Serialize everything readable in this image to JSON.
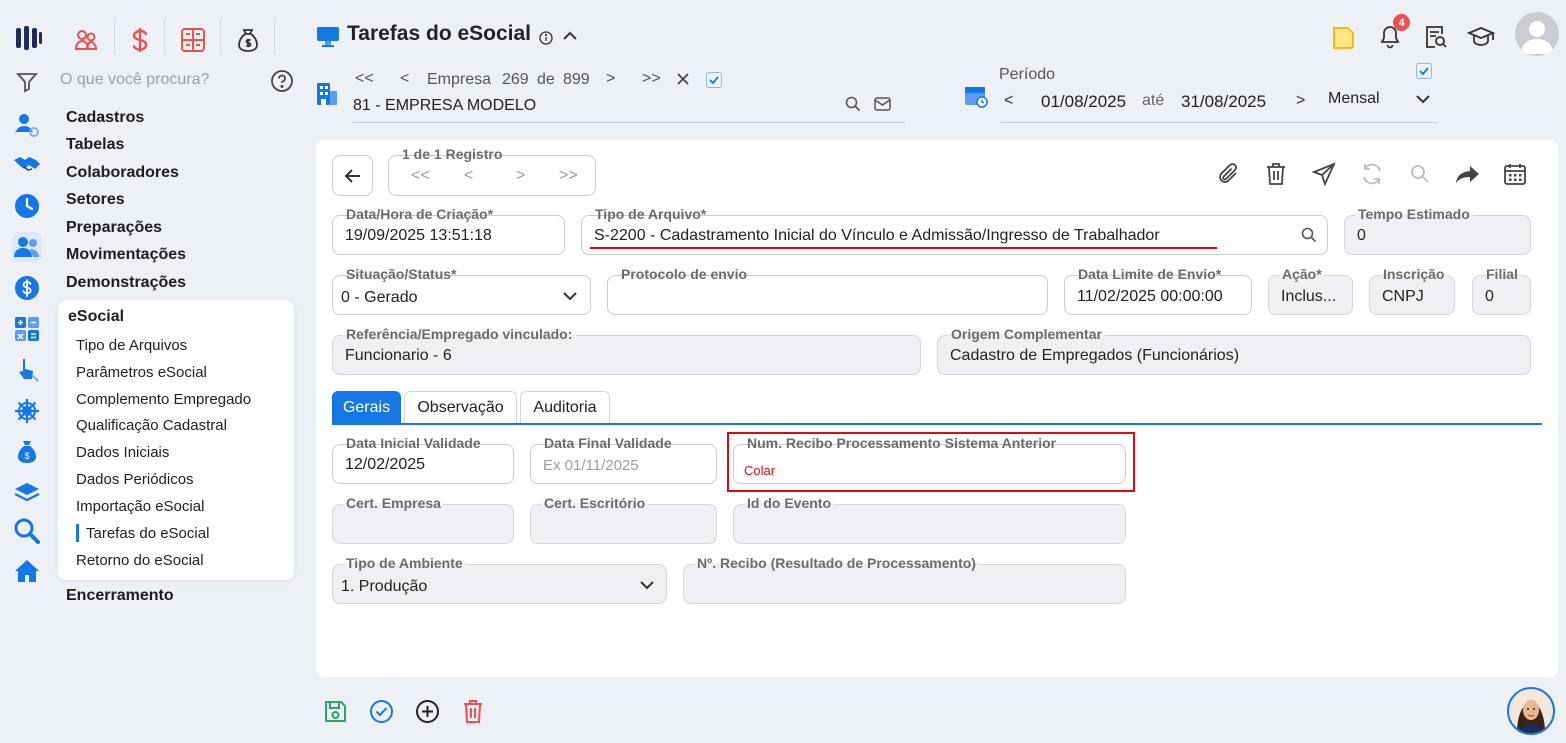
{
  "app": {
    "title": "Tarefas do eSocial",
    "search_placeholder": "O que você procura?",
    "notifications_count": "4"
  },
  "menu": {
    "main_items": [
      "Cadastros",
      "Tabelas",
      "Colaboradores",
      "Setores",
      "Preparações",
      "Movimentações",
      "Demonstrações"
    ],
    "submenu_title": "eSocial",
    "sub_items": [
      "Tipo de Arquivos",
      "Parâmetros eSocial",
      "Complemento Empregado",
      "Qualificação Cadastral",
      "Dados Iniciais",
      "Dados Periódicos",
      "Importação eSocial",
      "Tarefas do eSocial",
      "Retorno do eSocial"
    ],
    "active_sub_item": "Tarefas do eSocial",
    "last_item": "Encerramento"
  },
  "company": {
    "nav_label": "Empresa",
    "current": "269",
    "of_label": "de",
    "total": "899",
    "name": "81 - EMPRESA MODELO"
  },
  "period": {
    "label": "Período",
    "start": "01/08/2025",
    "until": "até",
    "end": "31/08/2025",
    "mode": "Mensal"
  },
  "record_nav": {
    "label": "1 de 1 Registro"
  },
  "form": {
    "creation": {
      "label": "Data/Hora de Criação*",
      "value": "19/09/2025 13:51:18"
    },
    "file_type": {
      "label": "Tipo de Arquivo*",
      "value": "S-2200 - Cadastramento Inicial do Vínculo e Admissão/Ingresso de Trabalhador"
    },
    "estimated_time": {
      "label": "Tempo Estimado",
      "value": "0"
    },
    "status": {
      "label": "Situação/Status*",
      "value": "0 - Gerado"
    },
    "protocol": {
      "label": "Protocolo de envio",
      "value": ""
    },
    "deadline": {
      "label": "Data Limite de Envio*",
      "value": "11/02/2025 00:00:00"
    },
    "action": {
      "label": "Ação*",
      "value": "Inclus..."
    },
    "registration": {
      "label": "Inscrição",
      "value": "CNPJ"
    },
    "branch": {
      "label": "Filial",
      "value": "0"
    },
    "reference": {
      "label": "Referência/Empregado vinculado:",
      "value": "Funcionario - 6"
    },
    "origin": {
      "label": "Origem Complementar",
      "value": "Cadastro de Empregados (Funcionários)"
    }
  },
  "tabs": [
    "Gerais",
    "Observação",
    "Auditoria"
  ],
  "gerais": {
    "start_validity": {
      "label": "Data Inicial Validade",
      "value": "12/02/2025"
    },
    "end_validity": {
      "label": "Data Final Validade",
      "placeholder": "Ex 01/11/2025"
    },
    "receipt_prev": {
      "label": "Num. Recibo Processamento Sistema Anterior",
      "value": "Colar"
    },
    "cert_company": {
      "label": "Cert. Empresa",
      "value": ""
    },
    "cert_office": {
      "label": "Cert. Escritório",
      "value": ""
    },
    "event_id": {
      "label": "Id do Evento",
      "value": ""
    },
    "environment": {
      "label": "Tipo de Ambiente",
      "value": "1. Produção"
    },
    "receipt_result": {
      "label": "Nº. Recibo (Resultado de Processamento)",
      "value": ""
    }
  },
  "colors": {
    "accent": "#1677e6",
    "highlight_box": "#e30613",
    "underline_red": "#e30613",
    "icon_red": "#ef4f4f",
    "save_green": "#2aa56a"
  }
}
